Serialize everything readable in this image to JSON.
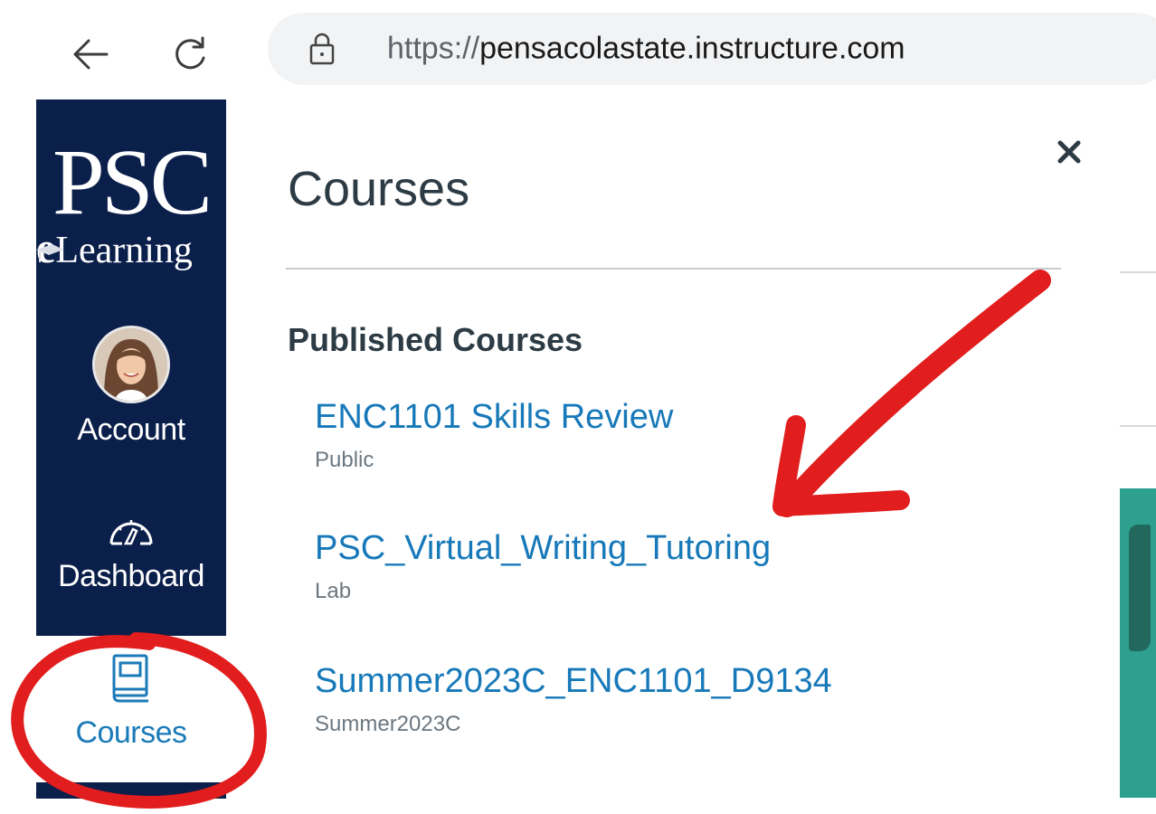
{
  "browser": {
    "url_scheme": "https://",
    "url_host": "pensacolastate.instructure.com",
    "icons": [
      "back-arrow-icon",
      "reload-icon",
      "lock-icon"
    ]
  },
  "global_nav": {
    "logo_main": "PSC",
    "logo_e": "e",
    "logo_sub": "Learning",
    "items": [
      {
        "label": "Account",
        "icon": "avatar"
      },
      {
        "label": "Dashboard",
        "icon": "dashboard-gauge-icon"
      },
      {
        "label": "Courses",
        "icon": "courses-book-icon",
        "active": true
      }
    ]
  },
  "tray": {
    "title": "Courses",
    "close_icon": "close-icon",
    "section_title": "Published Courses",
    "courses": [
      {
        "name": "ENC1101 Skills Review",
        "term": "Public"
      },
      {
        "name": "PSC_Virtual_Writing_Tutoring",
        "term": "Lab"
      },
      {
        "name": "Summer2023C_ENC1101_D9134",
        "term": "Summer2023C"
      }
    ]
  },
  "colors": {
    "nav_bg": "#0b1f4b",
    "link": "#1779b9",
    "heading": "#2d3b45",
    "annotation_red": "#e11d1d"
  }
}
